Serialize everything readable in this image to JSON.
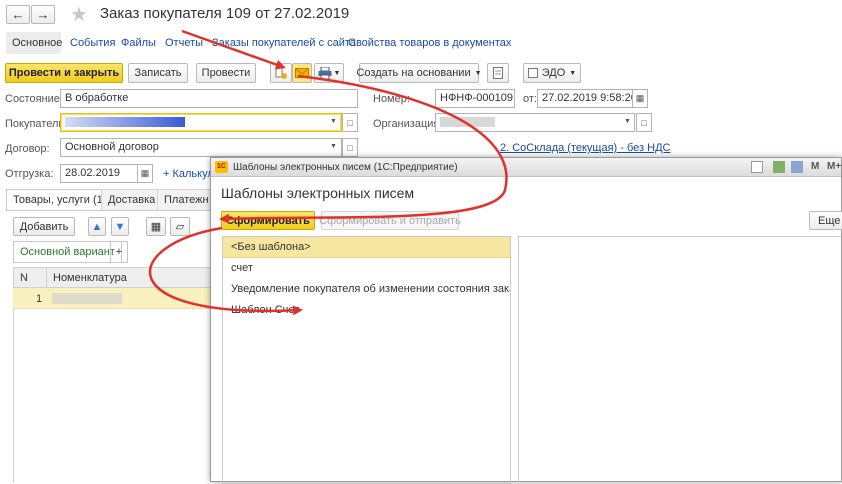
{
  "doc": {
    "title": "Заказ покупателя 109 от 27.02.2019",
    "nav": [
      "Основное",
      "События",
      "Файлы",
      "Отчеты",
      "Заказы покупателей с сайта",
      "Свойства товаров в документах"
    ],
    "toolbar": {
      "post_close": "Провести и закрыть",
      "save": "Записать",
      "post": "Провести",
      "create_based": "Создать на основании",
      "edo": "ЭДО"
    },
    "fields": {
      "status_label": "Состояние:",
      "status_value": "В обработке",
      "buyer_label": "Покупатель:",
      "contract_label": "Договор:",
      "contract_value": "Основной договор",
      "shipment_label": "Отгрузка:",
      "shipment_value": "28.02.2019",
      "calc_link": "+ Калькуля",
      "number_label": "Номер:",
      "number_value": "НФНФ-000109",
      "date_label": "от:",
      "date_value": "27.02.2019  9:58:20",
      "org_label": "Организация:",
      "warehouse_link": "2. СоСклада (текущая) - без НДС"
    },
    "tabs": [
      "Товары, услуги (1)",
      "Доставка",
      "Платежн"
    ],
    "table": {
      "add_button": "Добавить",
      "variant_tab": "Основной вариант",
      "plus_tab": "+",
      "col_n": "N",
      "col_nom": "Номенклатура",
      "row_n": "1"
    }
  },
  "dialog": {
    "window_title": "Шаблоны электронных писем  (1С:Предприятие)",
    "titlebar_m": "M",
    "titlebar_mplus": "M+",
    "heading": "Шаблоны электронных писем",
    "form_button": "Сформировать",
    "form_send_button": "Сформировать и отправить",
    "more_button": "Еще",
    "items": [
      "<Без шаблона>",
      "счет",
      "Уведомление покупателя об изменении состояния заказа",
      "Шаблон Счет"
    ]
  },
  "colors": {
    "accent_yellow": "#f5d130",
    "selection": "#f7eaa4",
    "link_blue": "#1a4aa8",
    "annotation_red": "#e0322d"
  }
}
